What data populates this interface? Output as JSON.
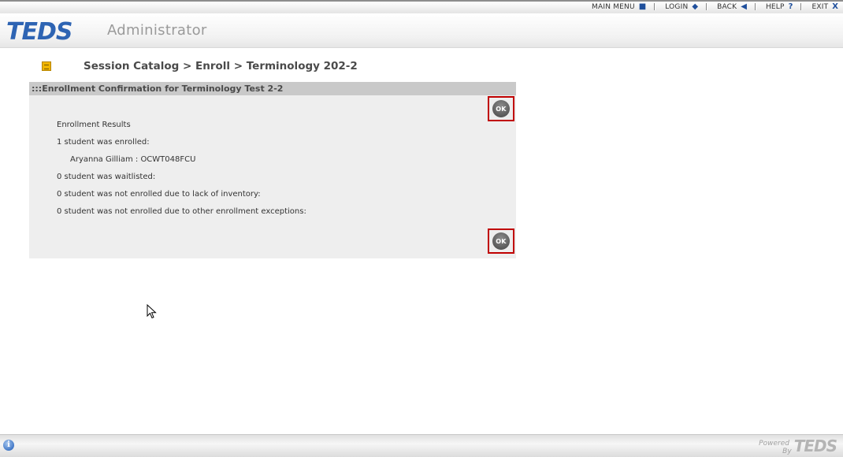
{
  "topnav": {
    "items": [
      {
        "label": "MAIN MENU",
        "icon": "■"
      },
      {
        "label": "LOGIN",
        "icon": "◆"
      },
      {
        "label": "BACK",
        "icon": "◀"
      },
      {
        "label": "HELP",
        "icon": "?"
      },
      {
        "label": "EXIT",
        "icon": "X"
      }
    ]
  },
  "header": {
    "logo": "TEDS",
    "app_name": "Administrator"
  },
  "breadcrumb": "Session Catalog > Enroll > Terminology 202-2",
  "panel": {
    "title": ":::Enrollment Confirmation for Terminology Test 2-2",
    "ok_top": "OK",
    "ok_bottom": "OK",
    "results": {
      "heading": "Enrollment Results",
      "enrolled": "1 student was enrolled:",
      "student": "Aryanna Gilliam : OCWT048FCU",
      "waitlisted": "0 student was waitlisted:",
      "no_inventory": "0 student was not enrolled due to lack of inventory:",
      "exceptions": "0 student was not enrolled due to other enrollment exceptions:"
    }
  },
  "footer": {
    "info_icon": "i",
    "powered": "Powered",
    "by": "By",
    "logo": "TEDS"
  },
  "colors": {
    "brand_blue": "#2e64b3",
    "panel_bg": "#eeeeee",
    "panel_title_bg": "#c9c9c9",
    "highlight_red": "#c00000"
  }
}
